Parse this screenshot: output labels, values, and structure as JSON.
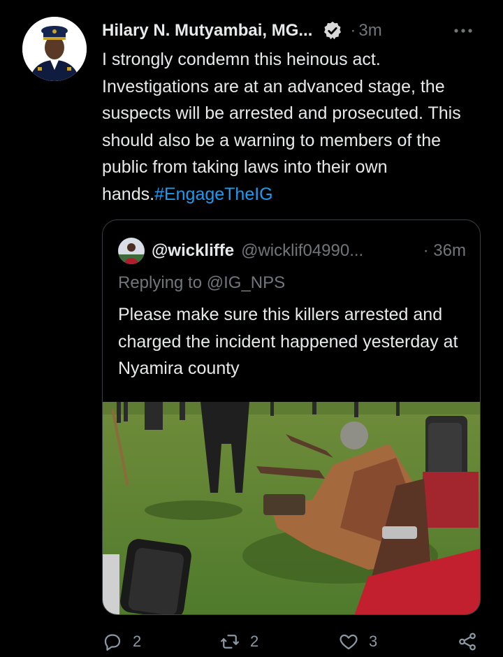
{
  "tweet": {
    "author_name": "Hilary N. Mutyambai, MG...",
    "separator": "·",
    "time": "3m",
    "text": "I strongly condemn this heinous act. Investigations are at an advanced stage, the suspects will be arrested and prosecuted. This should also be a warning to members of the public from taking laws into their own hands.",
    "hashtag": "#EngageTheIG",
    "verified": true,
    "more_icon": "more-horizontal-icon"
  },
  "quote": {
    "name": "@wickliffe",
    "handle": "@wicklif04990...",
    "time": "· 36m",
    "replying_to": "Replying to @IG_NPS",
    "text": "Please make sure this killers arrested and charged the incident happened yesterday at Nyamira county",
    "media_icon": "photo"
  },
  "actions": {
    "reply_count": "2",
    "retweet_count": "2",
    "like_count": "3",
    "reply_icon": "reply-icon",
    "retweet_icon": "retweet-icon",
    "like_icon": "heart-icon",
    "share_icon": "share-icon"
  },
  "colors": {
    "background": "#000000",
    "text": "#e7e9ea",
    "secondary": "#71767b",
    "link": "#1d9bf0",
    "border": "#3a3f44"
  }
}
